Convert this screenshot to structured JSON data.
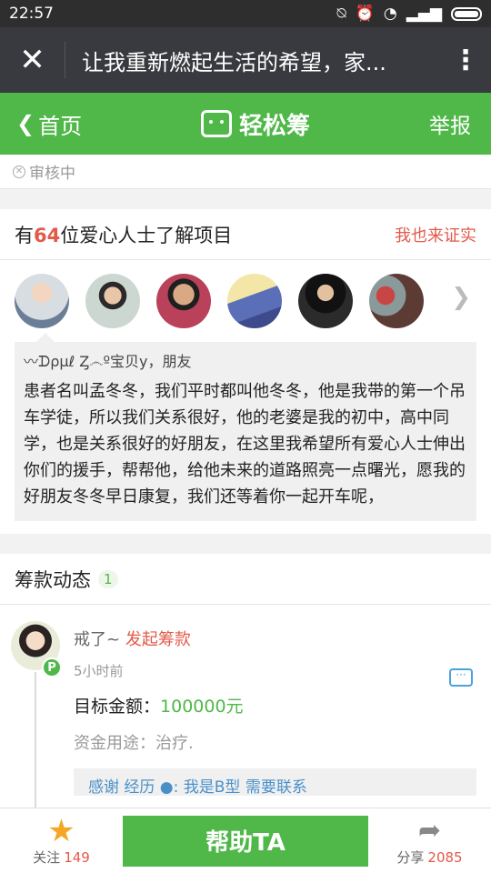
{
  "status_bar": {
    "time": "22:57"
  },
  "titlebar": {
    "close_icon": "close-icon",
    "title": "让我重新燃起生活的希望，家...",
    "more_icon": "more-vert-icon"
  },
  "navbar": {
    "back_label": "首页",
    "brand": "轻松筹",
    "report": "举报",
    "accent": "#4fb848"
  },
  "status_card": {
    "label": "审核中"
  },
  "verify": {
    "prefix": "有",
    "count": "64",
    "suffix": "位爱心人士了解项目",
    "link": "我也来证实",
    "avatars": [
      "avatar-1",
      "avatar-2",
      "avatar-3",
      "avatar-4",
      "avatar-5",
      "avatar-6"
    ]
  },
  "comment": {
    "who": "〰ᗪρμℓ Ȥ෴º宝贝y，朋友",
    "text": "患者名叫孟冬冬，我们平时都叫他冬冬，他是我带的第一个吊车学徒，所以我们关系很好，他的老婆是我的初中，高中同学，也是关系很好的好朋友，在这里我希望所有爱心人士伸出你们的援手，帮帮他，给他未来的道路照亮一点曙光，愿我的好朋友冬冬早日康复，我们还等着你一起开车呢，"
  },
  "fund": {
    "title": "筹款动态",
    "count": "1",
    "item": {
      "name": "戒了~",
      "action": "发起筹款",
      "badge": "P",
      "time": "5小时前",
      "target_label": "目标金额：",
      "target_amount": "100000元",
      "usage": "资金用途：治疗.",
      "tags": "感谢 经历 ●: 我是B型 需要联系"
    }
  },
  "bottom": {
    "follow_label": "关注",
    "follow_count": "149",
    "help_label": "帮助TA",
    "share_label": "分享",
    "share_count": "2085"
  }
}
